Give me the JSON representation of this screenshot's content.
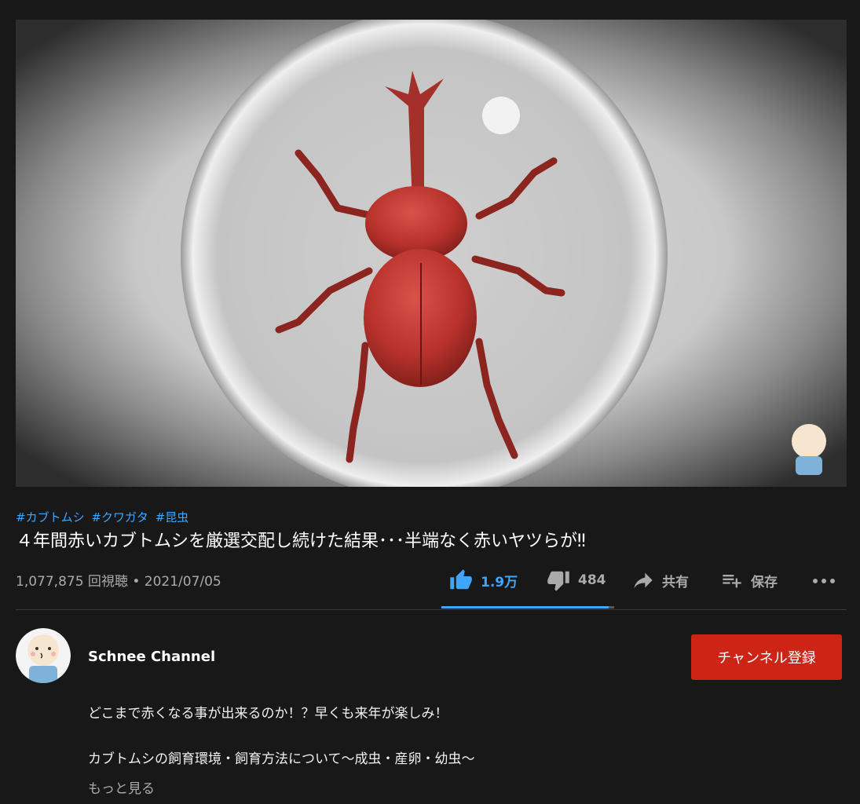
{
  "video": {
    "player_label": "video-player"
  },
  "hashtags": [
    "#カブトムシ",
    "#クワガタ",
    "#昆虫"
  ],
  "title": "４年間赤いカブトムシを厳選交配し続けた結果･･･半端なく赤いヤツらが‼︎",
  "views": "1,077,875 回視聴 • 2021/07/05",
  "actions": {
    "like_count": "1.9万",
    "dislike_count": "484",
    "share_label": "共有",
    "save_label": "保存",
    "more_icon": "more-horizontal-icon"
  },
  "like_ratio": 0.97,
  "channel": {
    "name": "Schnee Channel",
    "subscribe_label": "チャンネル登録"
  },
  "description": {
    "line1": "どこまで赤くなる事が出来るのか！？早くも来年が楽しみ！",
    "line2": "カブトムシの飼育環境・飼育方法について〜成虫・産卵・幼虫〜",
    "show_more": "もっと見る"
  },
  "colors": {
    "accent_blue": "#3ea6ff",
    "subscribe_red": "#cc2516",
    "background": "#181818"
  }
}
